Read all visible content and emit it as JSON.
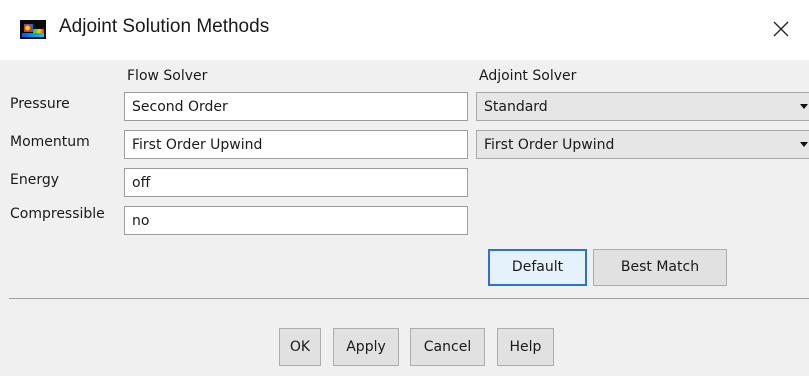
{
  "window": {
    "title": "Adjoint Solution Methods",
    "icon": "fluent-app-icon",
    "close_icon": "close-icon"
  },
  "columns": {
    "flow_solver": "Flow Solver",
    "adjoint_solver": "Adjoint Solver"
  },
  "rows": [
    {
      "label": "Pressure",
      "flow_value": "Second Order",
      "adjoint_value": "Standard"
    },
    {
      "label": "Momentum",
      "flow_value": "First Order Upwind",
      "adjoint_value": "First Order Upwind"
    },
    {
      "label": "Energy",
      "flow_value": "off"
    },
    {
      "label": "Compressible",
      "flow_value": "no"
    }
  ],
  "buttons": {
    "default": "Default",
    "best_match": "Best Match",
    "ok": "OK",
    "apply": "Apply",
    "cancel": "Cancel",
    "help": "Help"
  },
  "colors": {
    "focus_border": "#2a72d8",
    "button_bg": "#e1e1e1",
    "dialog_bg": "#f0f0f0"
  }
}
